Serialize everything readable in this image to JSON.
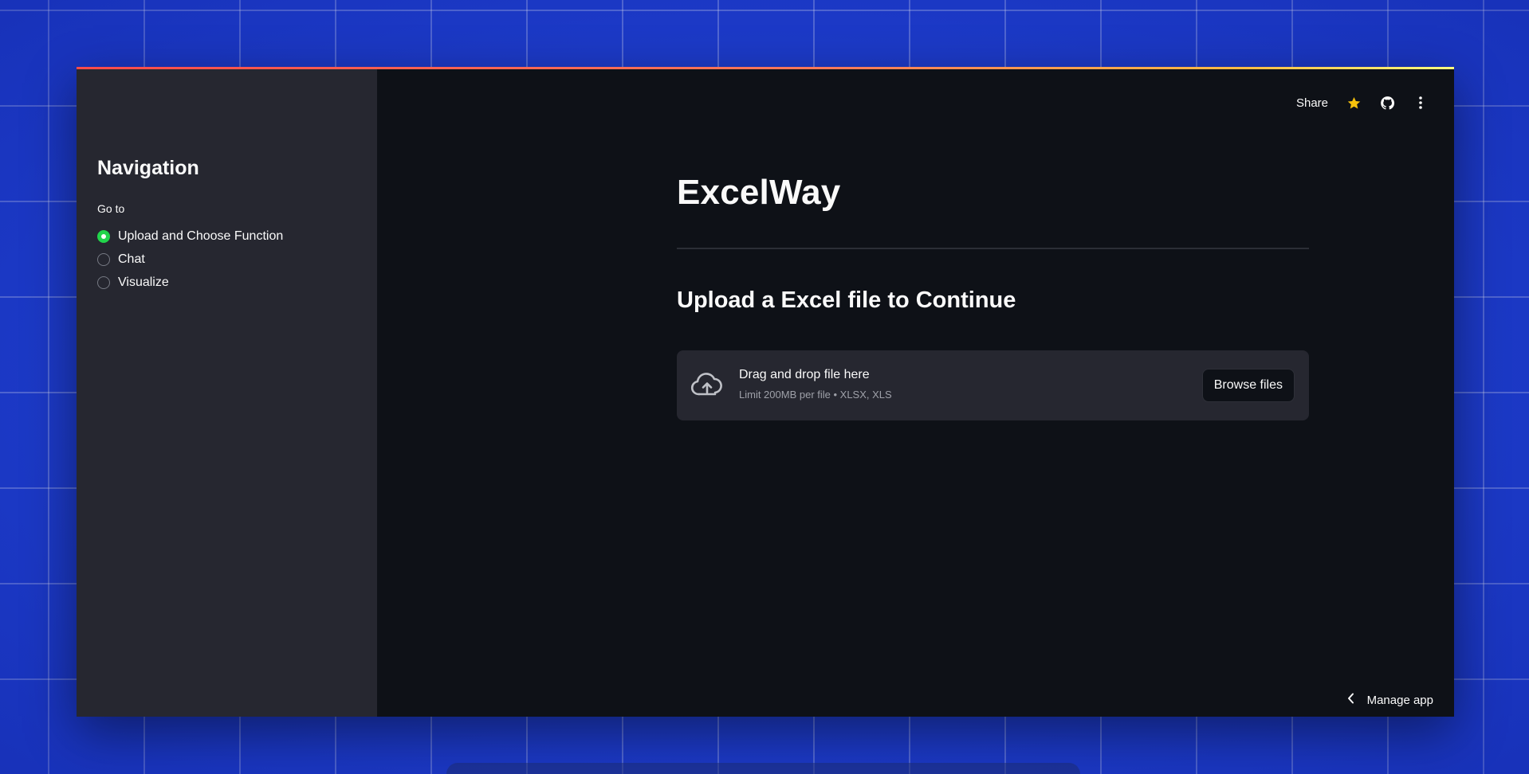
{
  "header": {
    "share_label": "Share",
    "icons": [
      "star-icon",
      "github-icon",
      "more-vertical-icon"
    ],
    "star_color": "#f6c20c"
  },
  "sidebar": {
    "title": "Navigation",
    "radio_label": "Go to",
    "options": [
      {
        "label": "Upload and Choose Function",
        "selected": true
      },
      {
        "label": "Chat",
        "selected": false
      },
      {
        "label": "Visualize",
        "selected": false
      }
    ],
    "selected_color": "#21d44b"
  },
  "main": {
    "title": "ExcelWay",
    "upload_heading": "Upload a Excel file to Continue",
    "uploader": {
      "primary_text": "Drag and drop file here",
      "secondary_text": "Limit 200MB per file • XLSX, XLS",
      "button_label": "Browse files",
      "icon": "cloud-upload-icon"
    }
  },
  "footer": {
    "manage_app_label": "Manage app",
    "icon": "chevron-left-icon"
  },
  "colors": {
    "accent_gradient": [
      "#ff4b4b",
      "#ffbd45",
      "#fffd80"
    ],
    "sidebar_bg": "#262730",
    "main_bg": "#0e1117"
  }
}
